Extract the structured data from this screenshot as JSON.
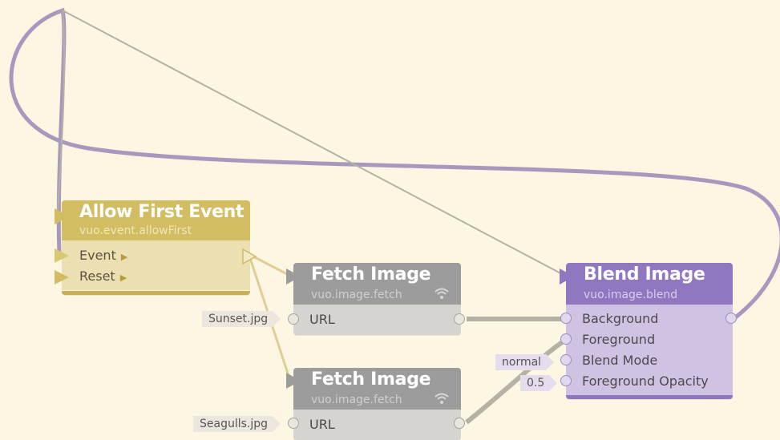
{
  "colors": {
    "background": "#fdf6e3",
    "event_node_header": "#d2bd62",
    "event_node_body": "#ece0b2",
    "gray_node_header": "#9c9c9c",
    "gray_node_body": "#d6d4d0",
    "blend_node_header": "#8f78c0",
    "blend_node_body": "#cfc2e3",
    "purple_cable": "#a898be",
    "gray_cable": "#b6b1a5",
    "event_cable": "#ddd092"
  },
  "nodes": {
    "allow_first_event": {
      "title": "Allow First Event",
      "class_name": "vuo.event.allowFirst",
      "inputs": [
        "Event",
        "Reset"
      ]
    },
    "fetch_image_1": {
      "title": "Fetch Image",
      "class_name": "vuo.image.fetch",
      "icon": "wifi-icon",
      "inputs": [
        "URL"
      ],
      "url_constant": "Sunset.jpg"
    },
    "fetch_image_2": {
      "title": "Fetch Image",
      "class_name": "vuo.image.fetch",
      "icon": "wifi-icon",
      "inputs": [
        "URL"
      ],
      "url_constant": "Seagulls.jpg"
    },
    "blend_image": {
      "title": "Blend Image",
      "class_name": "vuo.image.blend",
      "inputs": [
        "Background",
        "Foreground",
        "Blend Mode",
        "Foreground Opacity"
      ],
      "blend_mode_constant": "normal",
      "opacity_constant": "0.5"
    }
  }
}
